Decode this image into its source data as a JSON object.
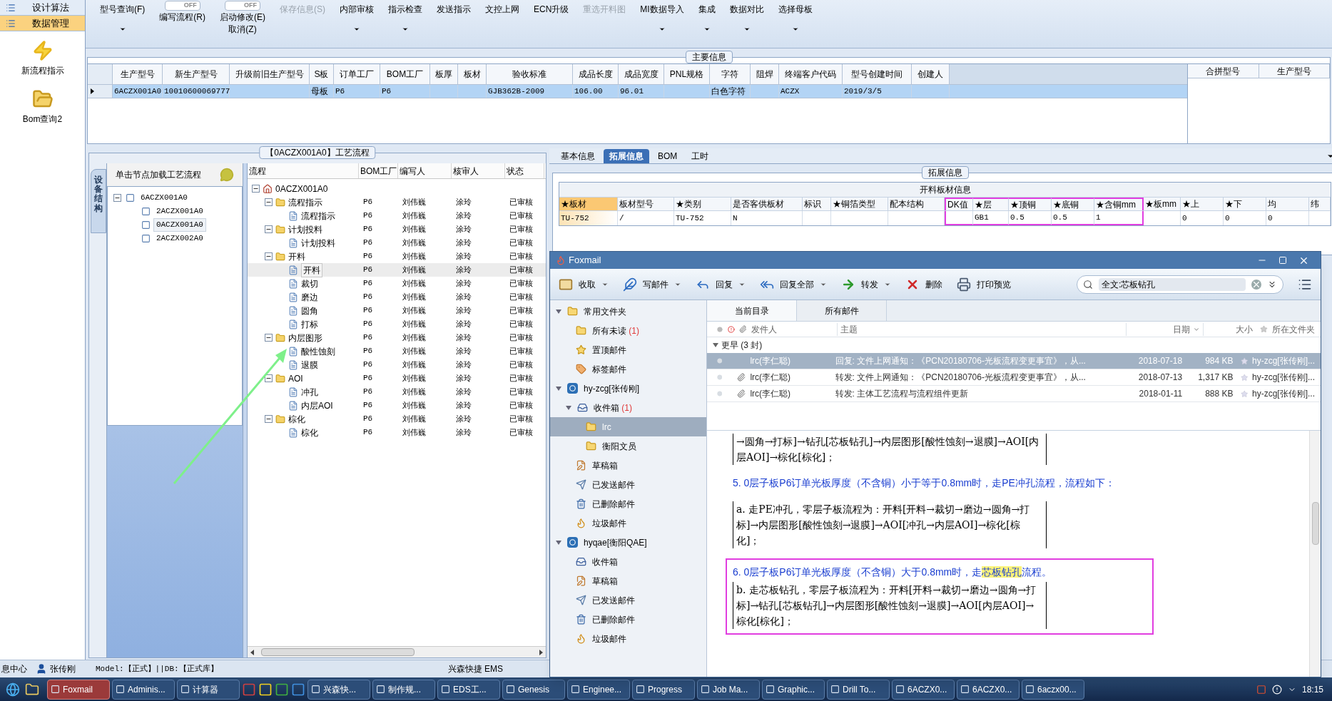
{
  "sidebar": {
    "items": [
      {
        "kind": "tab",
        "label": "设计算法",
        "selected": false
      },
      {
        "kind": "tab",
        "label": "数据管理",
        "selected": true
      },
      {
        "kind": "launcher",
        "label": "新流程指示"
      },
      {
        "kind": "launcher",
        "label": "Bom查询2"
      }
    ]
  },
  "ribbon": [
    {
      "kind": "menu",
      "label": "型号查询(F)",
      "caret": true,
      "disabled": false
    },
    {
      "kind": "toggle",
      "switch": "OFF",
      "on": false,
      "lines": [
        "编写流程(R)"
      ]
    },
    {
      "kind": "toggle",
      "switch": "OFF",
      "on": false,
      "lines": [
        "启动修改(E)",
        "取消(Z)"
      ]
    },
    {
      "kind": "menu",
      "label": "保存信息(S)",
      "caret": false,
      "disabled": true
    },
    {
      "kind": "menu",
      "label": "内部审核",
      "caret": true,
      "disabled": false
    },
    {
      "kind": "menu",
      "label": "指示检查",
      "caret": true,
      "disabled": false
    },
    {
      "kind": "menu",
      "label": "发送指示",
      "caret": false,
      "disabled": false
    },
    {
      "kind": "menu",
      "label": "文控上网",
      "caret": false,
      "disabled": false
    },
    {
      "kind": "menu",
      "label": "ECN升级",
      "caret": false,
      "disabled": false
    },
    {
      "kind": "menu",
      "label": "重选开料图",
      "caret": false,
      "disabled": true
    },
    {
      "kind": "menu",
      "label": "MI数据导入",
      "caret": true,
      "disabled": false
    },
    {
      "kind": "menu",
      "label": "集成",
      "caret": true,
      "disabled": false
    },
    {
      "kind": "menu",
      "label": "数据对比",
      "caret": true,
      "disabled": false
    },
    {
      "kind": "menu",
      "label": "选择母板",
      "caret": true,
      "disabled": false
    }
  ],
  "main_info": {
    "title": "主要信息",
    "columns": [
      "生产型号",
      "新生产型号",
      "升级前旧生产型号",
      "S板",
      "订单工厂",
      "BOM工厂",
      "板厚",
      "板材",
      "验收标准",
      "成品长度",
      "成品宽度",
      "PNL规格",
      "字符",
      "阻焊",
      "终端客户代码",
      "型号创建时间",
      "创建人"
    ],
    "rows": [
      {
        "selected": true,
        "cells": [
          "6ACZX001A0",
          "10010600069777",
          null,
          "母板",
          "P6",
          "P6",
          null,
          null,
          "GJB362B-2009",
          "106.00",
          "96.01",
          null,
          "白色字符",
          null,
          "ACZX",
          "2019/3/5",
          null
        ]
      }
    ],
    "merge_columns": [
      "合拼型号",
      "生产型号"
    ]
  },
  "process": {
    "title": "【0ACZX001A0】工艺流程",
    "side_tab": "设备结构",
    "tree_header": "单击节点加载工艺流程",
    "models": [
      {
        "label": "6ACZX001A0",
        "expanded": true,
        "selected": false,
        "children": [
          {
            "label": "2ACZX001A0",
            "selected": false
          },
          {
            "label": "0ACZX001A0",
            "selected": true
          },
          {
            "label": "2ACZX002A0",
            "selected": false
          }
        ]
      }
    ],
    "columns": [
      "流程",
      "BOM工厂",
      "编写人",
      "核审人",
      "状态"
    ],
    "flow": [
      {
        "label": "0ACZX001A0",
        "expanded": true,
        "selected": false,
        "children": [
          {
            "label": "流程指示",
            "bom": "P6",
            "writer": "刘伟巍",
            "reviewer": "涂玲",
            "status": "已审核",
            "expanded": true,
            "selected": false,
            "children": [
              {
                "label": "流程指示",
                "bom": "P6",
                "writer": "刘伟巍",
                "reviewer": "涂玲",
                "status": "已审核",
                "selected": false
              }
            ]
          },
          {
            "label": "计划投料",
            "bom": "P6",
            "writer": "刘伟巍",
            "reviewer": "涂玲",
            "status": "已审核",
            "expanded": true,
            "selected": false,
            "children": [
              {
                "label": "计划投料",
                "bom": "P6",
                "writer": "刘伟巍",
                "reviewer": "涂玲",
                "status": "已审核",
                "selected": false
              }
            ]
          },
          {
            "label": "开料",
            "bom": "P6",
            "writer": "刘伟巍",
            "reviewer": "涂玲",
            "status": "已审核",
            "expanded": true,
            "selected": false,
            "children": [
              {
                "label": "开料",
                "bom": "P6",
                "writer": "刘伟巍",
                "reviewer": "涂玲",
                "status": "已审核",
                "selected": true
              },
              {
                "label": "裁切",
                "bom": "P6",
                "writer": "刘伟巍",
                "reviewer": "涂玲",
                "status": "已审核",
                "selected": false
              },
              {
                "label": "磨边",
                "bom": "P6",
                "writer": "刘伟巍",
                "reviewer": "涂玲",
                "status": "已审核",
                "selected": false
              },
              {
                "label": "圆角",
                "bom": "P6",
                "writer": "刘伟巍",
                "reviewer": "涂玲",
                "status": "已审核",
                "selected": false
              },
              {
                "label": "打标",
                "bom": "P6",
                "writer": "刘伟巍",
                "reviewer": "涂玲",
                "status": "已审核",
                "selected": false
              }
            ]
          },
          {
            "label": "内层图形",
            "bom": "P6",
            "writer": "刘伟巍",
            "reviewer": "涂玲",
            "status": "已审核",
            "expanded": true,
            "selected": false,
            "children": [
              {
                "label": "酸性蚀刻",
                "bom": "P6",
                "writer": "刘伟巍",
                "reviewer": "涂玲",
                "status": "已审核",
                "selected": false
              },
              {
                "label": "退膜",
                "bom": "P6",
                "writer": "刘伟巍",
                "reviewer": "涂玲",
                "status": "已审核",
                "selected": false
              }
            ]
          },
          {
            "label": "AOI",
            "bom": "P6",
            "writer": "刘伟巍",
            "reviewer": "涂玲",
            "status": "已审核",
            "expanded": true,
            "selected": false,
            "children": [
              {
                "label": "冲孔",
                "bom": "P6",
                "writer": "刘伟巍",
                "reviewer": "涂玲",
                "status": "已审核",
                "selected": false
              },
              {
                "label": "内层AOI",
                "bom": "P6",
                "writer": "刘伟巍",
                "reviewer": "涂玲",
                "status": "已审核",
                "selected": false
              }
            ]
          },
          {
            "label": "棕化",
            "bom": "P6",
            "writer": "刘伟巍",
            "reviewer": "涂玲",
            "status": "已审核",
            "expanded": true,
            "selected": false,
            "children": [
              {
                "label": "棕化",
                "bom": "P6",
                "writer": "刘伟巍",
                "reviewer": "涂玲",
                "status": "已审核",
                "selected": false
              }
            ]
          }
        ]
      }
    ]
  },
  "detail": {
    "tabs": [
      {
        "label": "基本信息",
        "selected": false
      },
      {
        "label": "拓展信息",
        "selected": true
      },
      {
        "label": "BOM",
        "selected": false
      },
      {
        "label": "工时",
        "selected": false
      }
    ],
    "group_title": "拓展信息",
    "table_title": "开料板材信息",
    "columns": [
      {
        "label": "★板材",
        "value": "TU-752",
        "selected": true,
        "framed": false
      },
      {
        "label": "板材型号",
        "value": "/",
        "selected": false,
        "framed": false
      },
      {
        "label": "★类别",
        "value": "TU-752",
        "selected": false,
        "framed": false
      },
      {
        "label": "是否客供板材",
        "value": "N",
        "selected": false,
        "framed": false
      },
      {
        "label": "标识",
        "selected": false,
        "framed": false
      },
      {
        "label": "★铜箔类型",
        "selected": false,
        "framed": false
      },
      {
        "label": "配本结构",
        "selected": false,
        "framed": false
      },
      {
        "label": "DK值",
        "selected": false,
        "framed": true
      },
      {
        "label": "★层",
        "value": "GB1",
        "selected": false,
        "framed": true
      },
      {
        "label": "★顶铜",
        "value": "0.5",
        "selected": false,
        "framed": true
      },
      {
        "label": "★底铜",
        "value": "0.5",
        "selected": false,
        "framed": true
      },
      {
        "label": "★含铜mm",
        "value": "1",
        "selected": false,
        "framed": true
      },
      {
        "label": "★板mm",
        "selected": false,
        "framed": false
      },
      {
        "label": "★上",
        "value": "0",
        "selected": false,
        "framed": false
      },
      {
        "label": "★下",
        "value": "0",
        "selected": false,
        "framed": false
      },
      {
        "label": "均",
        "value": "0",
        "selected": false,
        "framed": false
      },
      {
        "label": "纬",
        "selected": false,
        "framed": false
      }
    ]
  },
  "foxmail": {
    "title": "Foxmail",
    "toolbar": [
      {
        "label": "收取",
        "caret": true
      },
      {
        "label": "写邮件",
        "caret": true
      },
      {
        "label": "回复",
        "caret": true
      },
      {
        "label": "回复全部",
        "caret": true
      },
      {
        "label": "转发",
        "caret": true
      },
      {
        "label": "删除",
        "caret": false
      },
      {
        "label": "打印预览",
        "caret": false
      }
    ],
    "search": {
      "value": "全文:芯板钻孔"
    },
    "folders": [
      {
        "kind": "group",
        "label": "常用文件夹",
        "expanded": true,
        "selected": false,
        "children": [
          {
            "kind": "folder",
            "label": "所有未读",
            "count": "(1)",
            "selected": false
          },
          {
            "kind": "pinned",
            "label": "置顶邮件",
            "selected": false
          },
          {
            "kind": "tag",
            "label": "标签邮件",
            "selected": false
          }
        ]
      },
      {
        "kind": "account",
        "label": "hy-zcg[张传刚]",
        "expanded": true,
        "selected": false,
        "children": [
          {
            "kind": "inbox",
            "label": "收件箱",
            "count": "(1)",
            "expanded": true,
            "selected": false,
            "children": [
              {
                "kind": "folder",
                "label": "lrc",
                "selected": true
              },
              {
                "kind": "folder",
                "label": "衡阳文员",
                "selected": false
              }
            ]
          },
          {
            "kind": "drafts",
            "label": "草稿箱",
            "selected": false
          },
          {
            "kind": "sent",
            "label": "已发送邮件",
            "selected": false
          },
          {
            "kind": "deleted",
            "label": "已删除邮件",
            "selected": false
          },
          {
            "kind": "junk",
            "label": "垃圾邮件",
            "selected": false
          }
        ]
      },
      {
        "kind": "account",
        "label": "hyqae[衡阳QAE]",
        "expanded": true,
        "selected": false,
        "children": [
          {
            "kind": "inbox",
            "label": "收件箱",
            "selected": false
          },
          {
            "kind": "drafts",
            "label": "草稿箱",
            "selected": false
          },
          {
            "kind": "sent",
            "label": "已发送邮件",
            "selected": false
          },
          {
            "kind": "deleted",
            "label": "已删除邮件",
            "selected": false
          },
          {
            "kind": "junk",
            "label": "垃圾邮件",
            "selected": false
          }
        ]
      }
    ],
    "tabs": [
      {
        "label": "当前目录",
        "selected": true
      },
      {
        "label": "所有邮件",
        "selected": false
      }
    ],
    "columns": [
      "发件人",
      "主题",
      "日期",
      "大小",
      "所在文件夹"
    ],
    "group": "更早 (3 封)",
    "messages": [
      {
        "sender": "lrc(李仁聪)",
        "subject": "回复: 文件上网通知：《PCN20180706-光板流程变更事宜》，从...",
        "date": "2018-07-18",
        "size": "984 KB",
        "folder": "hy-zcg[张传刚]...",
        "attachment": false,
        "selected": true
      },
      {
        "sender": "lrc(李仁聪)",
        "subject": "转发: 文件上网通知：《PCN20180706-光板流程变更事宜》，从...",
        "date": "2018-07-13",
        "size": "1,317 KB",
        "folder": "hy-zcg[张传刚]...",
        "attachment": true,
        "selected": false
      },
      {
        "sender": "lrc(李仁聪)",
        "subject": "转发: 主体工艺流程与流程组件更新",
        "date": "2018-01-11",
        "size": "888 KB",
        "folder": "hy-zcg[张传刚]...",
        "attachment": true,
        "selected": false
      }
    ],
    "body": [
      {
        "kind": "block",
        "text": "→圆角→打标]→钻孔[芯板钻孔]→内层图形[酸性蚀刻→退膜]→AOI[内层AOI]→棕化[棕化]；"
      },
      {
        "kind": "heading",
        "parts": [
          {
            "text": "5. 0层子板P6订单光板厚度（不含铜）小于等于0.8mm时，走PE冲孔流程，流程如下：",
            "highlight": false
          }
        ]
      },
      {
        "kind": "block",
        "text": "a. 走PE冲孔，零层子板流程为：开料[开料→裁切→磨边→圆角→打标]→内层图形[酸性蚀刻→退膜]→AOI[冲孔→内层AOI]→棕化[棕化]；"
      },
      {
        "kind": "frame",
        "children": [
          {
            "kind": "heading",
            "parts": [
              {
                "text": "6. 0层子板P6订单光板厚度（不含铜）大于0.8mm时，走",
                "highlight": false
              },
              {
                "text": "芯板钻孔",
                "highlight": true
              },
              {
                "text": "流程。",
                "highlight": false
              }
            ]
          },
          {
            "kind": "block",
            "text": "b. 走芯板钻孔，零层子板流程为：开料[开料→裁切→磨边→圆角→打标]→钻孔[芯板钻孔]→内层图形[酸性蚀刻→退膜]→AOI[内层AOI]→棕化[棕化]；"
          }
        ]
      }
    ]
  },
  "annotations": [
    {
      "kind": "arrow"
    }
  ],
  "status_bar": {
    "module": "息中心",
    "user": "张传刚",
    "environment": "Model:【正式】||DB:【正式库】",
    "company": "兴森快捷 EMS"
  },
  "taskbar": {
    "items": [
      {
        "label": "Foxmail",
        "selected": true
      },
      {
        "label": "Adminis...",
        "selected": false
      },
      {
        "label": "计算器",
        "selected": false
      },
      {
        "label": "兴森快...",
        "selected": false
      },
      {
        "label": "制作规...",
        "selected": false
      },
      {
        "label": "EDS工...",
        "selected": false
      },
      {
        "label": "Genesis",
        "selected": false
      },
      {
        "label": "Enginee...",
        "selected": false
      },
      {
        "label": "Progress",
        "selected": false
      },
      {
        "label": "Job Ma...",
        "selected": false
      },
      {
        "label": "Graphic...",
        "selected": false
      },
      {
        "label": "Drill To...",
        "selected": false
      },
      {
        "label": "6ACZX0...",
        "selected": false
      },
      {
        "label": "6ACZX0...",
        "selected": false
      },
      {
        "label": "6aczx00...",
        "selected": false
      }
    ],
    "clock": "18:15"
  }
}
